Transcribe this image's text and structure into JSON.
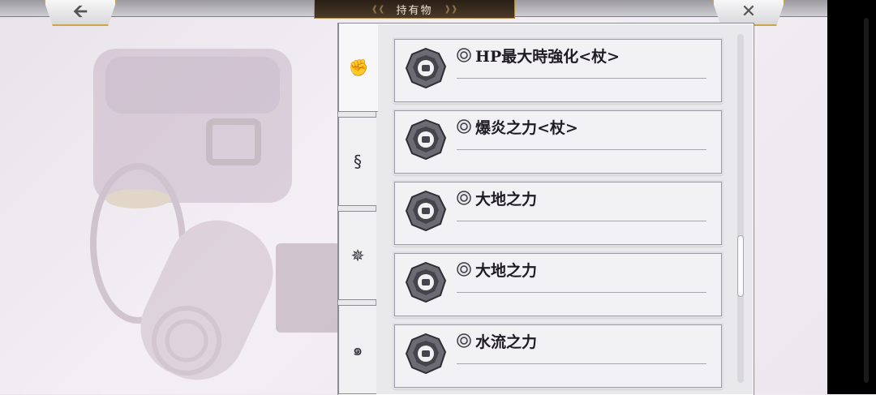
{
  "header": {
    "title": "持有物",
    "back_icon": "arrow-left-icon",
    "close_icon": "close-icon"
  },
  "tabs": [
    {
      "icon": "fist-icon",
      "glyph": "✊",
      "active": true
    },
    {
      "icon": "wind-swirl-icon",
      "glyph": "§",
      "active": false
    },
    {
      "icon": "star-compass-icon",
      "glyph": "✵",
      "active": false
    },
    {
      "icon": "water-wave-icon",
      "glyph": "๑",
      "active": false
    }
  ],
  "items": [
    {
      "name": "HP最大時強化<杖>",
      "icon": "fist-gem-icon"
    },
    {
      "name": "爆炎之力<杖>",
      "icon": "fist-gem-icon"
    },
    {
      "name": "大地之力",
      "icon": "fist-gem-icon"
    },
    {
      "name": "大地之力",
      "icon": "fist-gem-icon"
    },
    {
      "name": "水流之力",
      "icon": "fist-gem-icon"
    }
  ],
  "colors": {
    "accent_gold": "#c9a64a",
    "title_bg": "#3a2c1e",
    "gem": "#5b5961"
  }
}
